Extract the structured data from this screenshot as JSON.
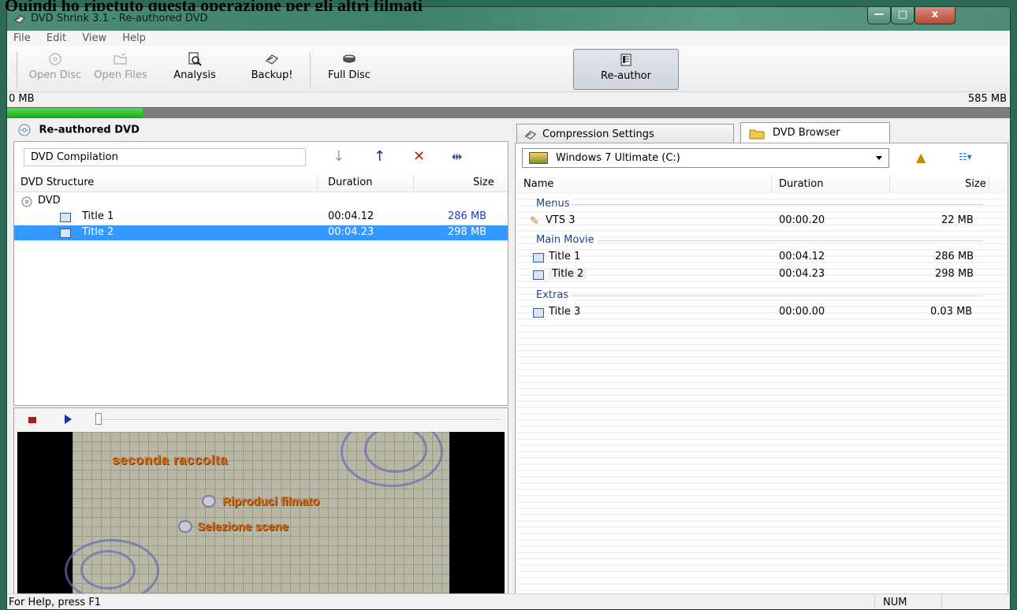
{
  "caption": "Quindi ho ripetuto questa operazione per gli altri filmati",
  "window": {
    "title": "DVD Shrink 3.1 - Re-authored DVD",
    "min": "—",
    "max": "□",
    "close": "x"
  },
  "menu": [
    "File",
    "Edit",
    "View",
    "Help"
  ],
  "toolbar": {
    "open_disc": "Open Disc",
    "open_files": "Open Files",
    "analysis": "Analysis",
    "backup": "Backup!",
    "full_disc": "Full Disc",
    "re_author": "Re-author"
  },
  "size": {
    "left": "0 MB",
    "right": "585 MB",
    "fill_percent": 13.5
  },
  "left": {
    "header": "Re-authored DVD",
    "compilation": "DVD Compilation",
    "columns": {
      "structure": "DVD Structure",
      "duration": "Duration",
      "size": "Size"
    },
    "root": "DVD",
    "rows": [
      {
        "name": "Title 1",
        "duration": "00:04.12",
        "size": "286 MB"
      },
      {
        "name": "Title 2",
        "duration": "00:04.23",
        "size": "298 MB"
      }
    ]
  },
  "video": {
    "line1": "seconda raccolta",
    "line2": "Riproduci filmato",
    "line3": "Selezione scene"
  },
  "tabs": {
    "compression": "Compression Settings",
    "browser": "DVD Browser"
  },
  "right": {
    "drive": "Windows 7 Ultimate (C:)",
    "columns": {
      "name": "Name",
      "duration": "Duration",
      "size": "Size"
    },
    "groups": {
      "menus": "Menus",
      "main": "Main Movie",
      "extras": "Extras"
    },
    "rows": {
      "vts": {
        "name": "VTS 3",
        "duration": "00:00.20",
        "size": "22 MB"
      },
      "t1": {
        "name": "Title 1",
        "duration": "00:04.12",
        "size": "286 MB"
      },
      "t2": {
        "name": "Title 2",
        "duration": "00:04.23",
        "size": "298 MB"
      },
      "t3": {
        "name": "Title 3",
        "duration": "00:00.00",
        "size": "0.03 MB"
      }
    }
  },
  "status": {
    "help": "For Help, press F1",
    "num": "NUM"
  }
}
